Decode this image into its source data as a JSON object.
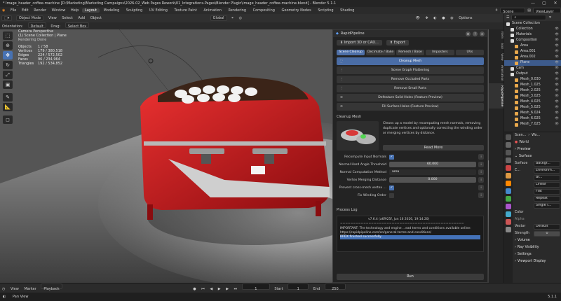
{
  "titlebar": {
    "title": "* Image_header_coffee-machine [D:\\Marketing\\Marketing Campaigns\\2026-02_Web Pages Rework\\01_Integrations-Pages\\Blender Plugin\\image_header_coffee-machine.blend] - Blender 5.1.1"
  },
  "menu": {
    "items": [
      "File",
      "Edit",
      "Render",
      "Window",
      "Help"
    ],
    "workspaces": [
      "Layout",
      "Modeling",
      "Sculpting",
      "UV Editing",
      "Texture Paint",
      "Animation",
      "Rendering",
      "Compositing",
      "Geometry Nodes",
      "Scripting",
      "Shading"
    ],
    "active_workspace": "Layout",
    "scene": "Scene",
    "view_layer": "ViewLayer"
  },
  "vp_header": {
    "mode": "Object Mode",
    "items": [
      "View",
      "Select",
      "Add",
      "Object"
    ],
    "transform": "Global",
    "options": "Options"
  },
  "vp_subheader": {
    "orientation_label": "Orientation:",
    "orientation": "Default",
    "drag_label": "Drag:",
    "drag": "Select Box"
  },
  "overlay": {
    "title": "Camera Perspective",
    "collection": "(1) Scene Collection | Plane",
    "status": "Rendering Done",
    "stats": [
      {
        "k": "Objects",
        "v": "1 / 58"
      },
      {
        "k": "Vertices",
        "v": "179 / 380,518"
      },
      {
        "k": "Edges",
        "v": "224 / 572,502"
      },
      {
        "k": "Faces",
        "v": "96 / 234,964"
      },
      {
        "k": "Triangles",
        "v": "192 / 534,852"
      }
    ]
  },
  "plugin": {
    "title": "RapidPipeline",
    "import_label": "Import 3D or CAD...",
    "export_label": "Export",
    "tabs": [
      "Scene Cleanup",
      "Decimate / Bake",
      "Remesh / Bake",
      "Imposters",
      "UVs"
    ],
    "active_tab": "Scene Cleanup",
    "operations": [
      "Cleanup Mesh",
      "Scene Graph Flattening",
      "Remove Occluded Parts",
      "Remove Small Parts",
      "Defeature Solid Holes (Feature Preview)",
      "Fill Surface Holes (Feature Preview)"
    ],
    "active_operation": "Cleanup Mesh",
    "section_title": "Cleanup Mesh",
    "description": "Cleans up a model by recomputing mesh normals, removing duplicate vertices and optionally correcting the winding order or merging vertices by distance.",
    "read_more": "Read More",
    "props": {
      "recompute_label": "Recompute Input Normals",
      "hard_angle_label": "Normal Hard Angle Threshold",
      "hard_angle_value": "60.000",
      "computation_label": "Normal Computation Method",
      "computation_value": "area",
      "merge_label": "Vertex Merging Distance",
      "merge_value": "0.000",
      "prevent_label": "Prevent cross-mesh vertex ...",
      "fix_label": "Fix Winding Order"
    },
    "log_title": "Process Log",
    "log_lines": [
      "v7.6.4 (a6f925f, Jun 16 2026, 19:14:20)",
      "================================================",
      "IMPORTANT: The technology and engine ...ead terms and conditions available online:",
      "https://rapidpipeline.com/en/general-terms-and-conditions/",
      "RPDX finished successfully."
    ],
    "run_label": "Run"
  },
  "vtabs": [
    "Item",
    "Tool",
    "View",
    "Animation",
    "RapidPipeline"
  ],
  "outliner": {
    "title": "Scene Collection",
    "items": [
      {
        "label": "Collection",
        "depth": 1,
        "color": "#ddd"
      },
      {
        "label": "Materials",
        "depth": 1,
        "color": "#ddd"
      },
      {
        "label": "Composition",
        "depth": 1,
        "color": "#ddd"
      },
      {
        "label": "Area",
        "depth": 2,
        "color": "#e8a84c"
      },
      {
        "label": "Area.001",
        "depth": 2,
        "color": "#e8a84c"
      },
      {
        "label": "Area.002",
        "depth": 2,
        "color": "#e8a84c"
      },
      {
        "label": "Plane",
        "depth": 2,
        "color": "#e8a84c"
      },
      {
        "label": "Cam",
        "depth": 1,
        "color": "#ddd"
      },
      {
        "label": "Output",
        "depth": 1,
        "color": "#ddd"
      },
      {
        "label": "Mesh_0.030",
        "depth": 2,
        "color": "#e8a84c"
      },
      {
        "label": "Mesh_1.025",
        "depth": 2,
        "color": "#e8a84c"
      },
      {
        "label": "Mesh_2.025",
        "depth": 2,
        "color": "#e8a84c"
      },
      {
        "label": "Mesh_3.025",
        "depth": 2,
        "color": "#e8a84c"
      },
      {
        "label": "Mesh_4.025",
        "depth": 2,
        "color": "#e8a84c"
      },
      {
        "label": "Mesh_5.025",
        "depth": 2,
        "color": "#e8a84c"
      },
      {
        "label": "Mesh_6.024",
        "depth": 2,
        "color": "#e8a84c"
      },
      {
        "label": "Mesh_6.025",
        "depth": 2,
        "color": "#e8a84c"
      },
      {
        "label": "Mesh_7.025",
        "depth": 2,
        "color": "#e8a84c"
      }
    ],
    "selected": "Plane"
  },
  "properties": {
    "header": "Scen...",
    "world_tab": "Wo...",
    "world_name": "World",
    "preview": "Preview",
    "surface": "Surface",
    "surface_label": "Surface",
    "surface_value": "Backgr...",
    "c_label": "C...",
    "c_value": "Environm...",
    "br_value": "Br...",
    "linear": "Linear",
    "flat": "Flat",
    "repeat": "Repeat",
    "single": "Single I...",
    "color_label": "Color",
    "alpha_label": "Alpha",
    "vector_label": "Vector",
    "vector_value": "Default",
    "strength_label": "Strength",
    "strength_value": "0",
    "volume": "Volume",
    "ray_visibility": "Ray Visibility",
    "settings": "Settings",
    "viewport_display": "Viewport Display"
  },
  "timeline": {
    "items": [
      "Playback",
      "View",
      "Marker"
    ],
    "frame": "1",
    "start_label": "Start",
    "start": "1",
    "end_label": "End",
    "end": "250"
  },
  "status": {
    "left": "Pan View",
    "right": "5.1.1"
  },
  "colors": {
    "accent": "#4772b3",
    "espresso_red": "#c8161a",
    "bg": "#1d1d1d"
  }
}
